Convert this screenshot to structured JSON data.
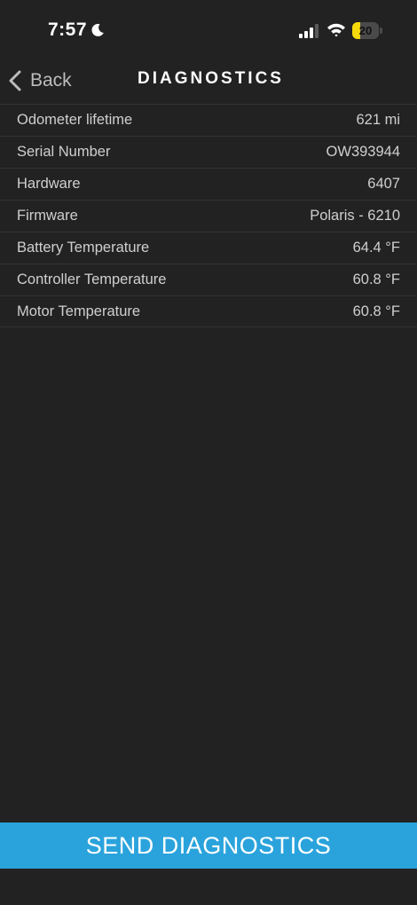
{
  "status_bar": {
    "time": "7:57",
    "battery_level": "20",
    "battery_color": "#f5d90a",
    "icons": [
      "moon-icon",
      "cellular-signal-icon",
      "wifi-icon",
      "battery-icon"
    ]
  },
  "nav": {
    "back_label": "Back",
    "title": "DIAGNOSTICS"
  },
  "diagnostics": [
    {
      "label": "Odometer lifetime",
      "value": "621 mi"
    },
    {
      "label": "Serial Number",
      "value": "OW393944"
    },
    {
      "label": "Hardware",
      "value": "6407"
    },
    {
      "label": "Firmware",
      "value": "Polaris - 6210"
    },
    {
      "label": "Battery Temperature",
      "value": "64.4 °F"
    },
    {
      "label": "Controller Temperature",
      "value": "60.8 °F"
    },
    {
      "label": "Motor Temperature",
      "value": "60.8 °F"
    }
  ],
  "send_button": {
    "label": "SEND DIAGNOSTICS",
    "color": "#2aa3dc"
  }
}
